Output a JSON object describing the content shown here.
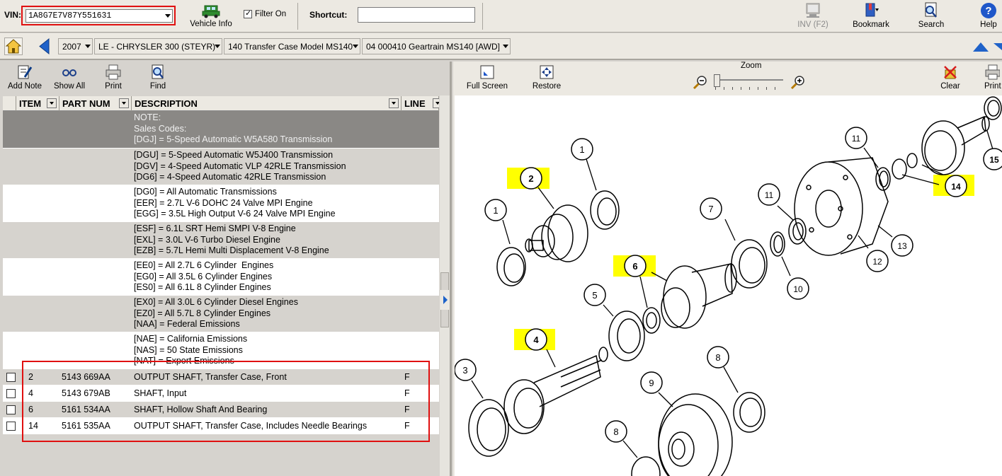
{
  "top": {
    "vin_label": "VIN:",
    "vin_value": "1A8G7E7V87Y551631",
    "vehicle_info": "Vehicle Info",
    "filter_label": "Filter On",
    "filter_checked": true,
    "shortcut_label": "Shortcut:",
    "shortcut_value": "",
    "inv": "INV (F2)",
    "bookmark": "Bookmark",
    "search": "Search",
    "help": "Help"
  },
  "nav": {
    "year": "2007",
    "model": "LE - CHRYSLER 300 (STEYR)",
    "group": "140 Transfer Case Model MS140",
    "subgroup": "04  000410  Geartrain MS140 [AWD]"
  },
  "left_toolbar": {
    "add_note": "Add Note",
    "show_all": "Show All",
    "print": "Print",
    "find": "Find"
  },
  "grid": {
    "headers": [
      "ITEM",
      "PART NUM",
      "DESCRIPTION",
      "LINE"
    ],
    "notes": [
      {
        "lines": [
          "NOTE:",
          "Sales Codes:",
          "[DGJ] = 5-Speed Automatic W5A580 Transmission"
        ]
      },
      {
        "lines": [
          "[DGU] = 5-Speed Automatic W5J400 Transmission",
          "[DGV] = 4-Speed Automatic VLP 42RLE Transmission",
          "[DG6] = 4-Speed Automatic 42RLE Transmission"
        ]
      },
      {
        "lines": [
          "[DG0] = All Automatic Transmissions",
          "[EER] = 2.7L V-6 DOHC 24 Valve MPI Engine",
          "[EGG] = 3.5L High Output V-6 24 Valve MPI Engine"
        ]
      },
      {
        "lines": [
          "[ESF] = 6.1L SRT Hemi SMPI V-8 Engine",
          "[EXL] = 3.0L V-6 Turbo Diesel Engine",
          "[EZB] = 5.7L Hemi Multi Displacement V-8 Engine"
        ]
      },
      {
        "lines": [
          "[EE0] = All 2.7L 6 Cylinder  Engines",
          "[EG0] = All 3.5L 6 Cylinder Engines",
          "[ES0] = All 6.1L 8 Cylinder Engines"
        ]
      },
      {
        "lines": [
          "[EX0] = All 3.0L 6 Cylinder Diesel Engines",
          "[EZ0] = All 5.7L 8 Cylinder Engines",
          "[NAA] = Federal Emissions"
        ]
      },
      {
        "lines": [
          "[NAE] = California Emissions",
          "[NAS] = 50 State Emissions",
          "[NAT] = Export Emissions"
        ]
      }
    ],
    "parts": [
      {
        "item": "2",
        "part": "5143 669AA",
        "desc": "OUTPUT SHAFT, Transfer Case, Front",
        "line": "F"
      },
      {
        "item": "4",
        "part": "5143 679AB",
        "desc": "SHAFT, Input",
        "line": "F"
      },
      {
        "item": "6",
        "part": "5161 534AA",
        "desc": "SHAFT,  Hollow Shaft And Bearing",
        "line": "F"
      },
      {
        "item": "14",
        "part": "5161 535AA",
        "desc": "OUTPUT SHAFT, Transfer Case,  Includes Needle Bearings",
        "line": "F"
      }
    ]
  },
  "right_toolbar": {
    "full_screen": "Full Screen",
    "restore": "Restore",
    "zoom": "Zoom",
    "clear": "Clear",
    "print": "Print"
  },
  "diagram": {
    "callouts": [
      "1",
      "2",
      "1",
      "4",
      "3",
      "5",
      "6",
      "7",
      "8",
      "9",
      "8",
      "10",
      "11",
      "11",
      "12",
      "13",
      "14",
      "15"
    ],
    "highlight_color": "#ffff00"
  }
}
